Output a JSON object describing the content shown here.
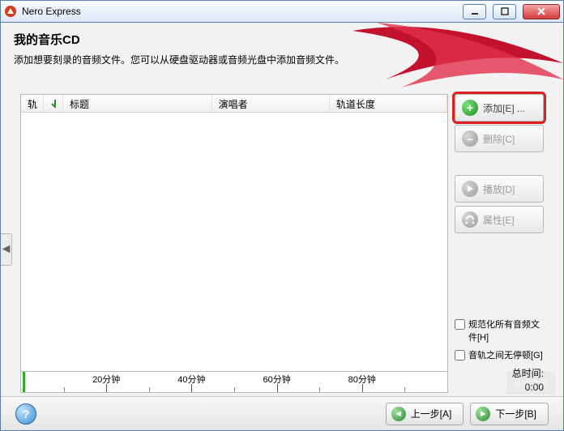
{
  "app": {
    "title": "Nero Express"
  },
  "header": {
    "title": "我的音乐CD",
    "desc": "添加想要刻录的音频文件。您可以从硬盘驱动器或音频光盘中添加音频文件。"
  },
  "columns": {
    "num": "轨",
    "title": "标题",
    "artist": "演唱者",
    "length": "轨道长度"
  },
  "side": {
    "add": "添加[E] ...",
    "delete": "删除[C]",
    "play": "播放[D]",
    "props": "属性[E]"
  },
  "checks": {
    "normalize": "规范化所有音频文件[H]",
    "nogap": "音轨之间无停顿[G]"
  },
  "total": {
    "label": "总时间:",
    "value": "0:00"
  },
  "ruler": {
    "t20": "20分钟",
    "t40": "40分钟",
    "t60": "60分钟",
    "t80": "80分钟"
  },
  "footer": {
    "back": "上一步[A]",
    "next": "下一步[B]"
  },
  "watermark": "系统之家"
}
